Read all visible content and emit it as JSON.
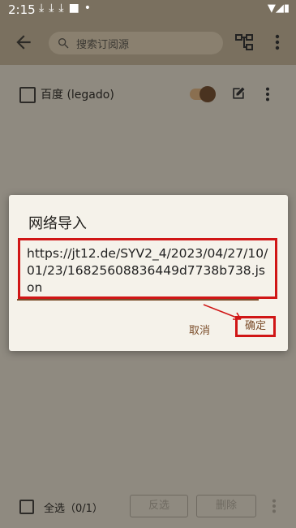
{
  "status": {
    "time": "2:15"
  },
  "search": {
    "placeholder": "搜索订阅源"
  },
  "list": {
    "items": [
      {
        "label": "百度 (legado)"
      }
    ]
  },
  "dialog": {
    "title": "网络导入",
    "url": "https://jt12.de/SYV2_4/2023/04/27/10/01/23/16825608836449d7738b738.json",
    "cancel_label": "取消",
    "confirm_label": "确定"
  },
  "bottom": {
    "select_all": "全选（0/1）",
    "invert": "反选",
    "delete": "删除"
  },
  "icons": {
    "back": "arrow-back-icon",
    "search": "search-icon",
    "tree": "sitemap-icon",
    "more": "more-vert-icon",
    "edit": "edit-icon"
  },
  "colors": {
    "accent": "#7b4d2a",
    "highlight": "#d01616"
  }
}
